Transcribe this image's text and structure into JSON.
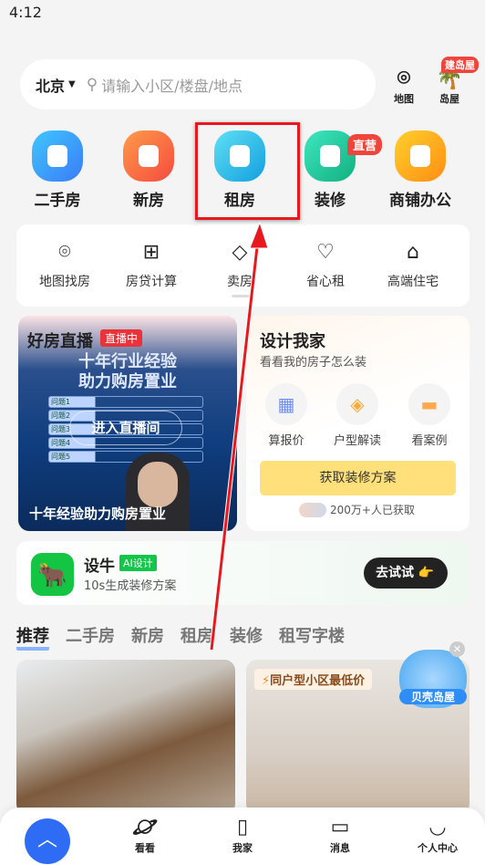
{
  "status": {
    "time": "4:12"
  },
  "search": {
    "city": "北京",
    "placeholder": "请输入小区/楼盘/地点"
  },
  "top_actions": [
    {
      "label": "地图",
      "icon": "map-pin-icon"
    },
    {
      "label": "岛屋",
      "icon": "palm-tree-icon",
      "badge": "建岛屋"
    }
  ],
  "categories": [
    {
      "label": "二手房",
      "color": "#3b8cf7"
    },
    {
      "label": "新房",
      "color": "#f8623f"
    },
    {
      "label": "租房",
      "color": "#1fb0e6"
    },
    {
      "label": "装修",
      "color": "#1ec59a",
      "badge": "直营"
    },
    {
      "label": "商铺办公",
      "color": "#ffa619"
    }
  ],
  "tools": [
    {
      "label": "地图找房"
    },
    {
      "label": "房贷计算"
    },
    {
      "label": "卖房"
    },
    {
      "label": "省心租"
    },
    {
      "label": "高端住宅"
    }
  ],
  "live": {
    "title": "好房直播",
    "badge": "直播中",
    "headline1": "十年行业经验",
    "headline2": "助力购房置业",
    "enter": "进入直播间",
    "questions": [
      "问题1",
      "问题2",
      "问题3",
      "问题4",
      "问题5"
    ],
    "caption": "十年经验助力购房置业"
  },
  "design": {
    "title": "设计我家",
    "subtitle": "看看我的房子怎么装",
    "items": [
      "算报价",
      "户型解读",
      "看案例"
    ],
    "button": "获取装修方案",
    "social": "200万+人已获取"
  },
  "banner": {
    "brand": "设牛",
    "tag": "AI设计",
    "desc": "10s生成装修方案",
    "button": "去试试"
  },
  "feed_tabs": [
    "推荐",
    "二手房",
    "新房",
    "租房",
    "装修",
    "租写字楼"
  ],
  "feed": {
    "right_tag": "同户型小区最低价",
    "float_label": "贝壳岛屋"
  },
  "nav": [
    "看看",
    "我家",
    "消息",
    "个人中心"
  ],
  "colors": {
    "accent": "#2f6cf6",
    "highlight": "#e8191e"
  }
}
